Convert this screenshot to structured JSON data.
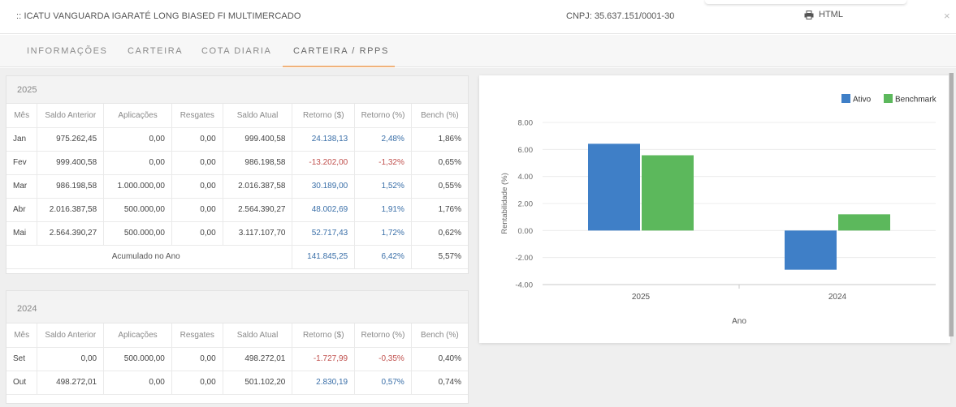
{
  "header": {
    "title": ":: ICATU VANGUARDA IGARATÉ LONG BIASED FI MULTIMERCADO",
    "cnpj": "CNPJ: 35.637.151/0001-30",
    "html_label": "HTML",
    "close_label": "×"
  },
  "tabs": [
    {
      "label": "INFORMAÇÕES"
    },
    {
      "label": "CARTEIRA"
    },
    {
      "label": "COTA DIARIA"
    },
    {
      "label": "CARTEIRA / RPPS"
    }
  ],
  "columns": [
    "Mês",
    "Saldo Anterior",
    "Aplicações",
    "Resgates",
    "Saldo Atual",
    "Retorno ($)",
    "Retorno (%)",
    "Bench (%)"
  ],
  "year_2025": {
    "year": "2025",
    "rows": [
      [
        "Jan",
        "975.262,45",
        "0,00",
        "0,00",
        "999.400,58",
        "24.138,13",
        "2,48%",
        "1,86%"
      ],
      [
        "Fev",
        "999.400,58",
        "0,00",
        "0,00",
        "986.198,58",
        "-13.202,00",
        "-1,32%",
        "0,65%"
      ],
      [
        "Mar",
        "986.198,58",
        "1.000.000,00",
        "0,00",
        "2.016.387,58",
        "30.189,00",
        "1,52%",
        "0,55%"
      ],
      [
        "Abr",
        "2.016.387,58",
        "500.000,00",
        "0,00",
        "2.564.390,27",
        "48.002,69",
        "1,91%",
        "1,76%"
      ],
      [
        "Mai",
        "2.564.390,27",
        "500.000,00",
        "0,00",
        "3.117.107,70",
        "52.717,43",
        "1,72%",
        "0,62%"
      ]
    ],
    "accum_label": "Acumulado no Ano",
    "accum_ret": "141.845,25",
    "accum_pct": "6,42%",
    "accum_bench": "5,57%"
  },
  "year_2024": {
    "year": "2024",
    "rows": [
      [
        "Set",
        "0,00",
        "500.000,00",
        "0,00",
        "498.272,01",
        "-1.727,99",
        "-0,35%",
        "0,40%"
      ],
      [
        "Out",
        "498.272,01",
        "0,00",
        "0,00",
        "501.102,20",
        "2.830,19",
        "0,57%",
        "0,74%"
      ]
    ]
  },
  "chart_data": {
    "type": "bar",
    "categories": [
      "2025",
      "2024"
    ],
    "series": [
      {
        "name": "Ativo",
        "values": [
          6.42,
          -2.9
        ],
        "color": "#3f7fc7"
      },
      {
        "name": "Benchmark",
        "values": [
          5.57,
          1.2
        ],
        "color": "#5cb85c"
      }
    ],
    "xlabel": "Ano",
    "ylabel": "Rentabilidade (%)",
    "yticks": [
      "8.00",
      "6.00",
      "4.00",
      "2.00",
      "0.00",
      "-2.00",
      "-4.00"
    ],
    "ylim": [
      -4,
      8
    ],
    "legend": "top-right"
  }
}
